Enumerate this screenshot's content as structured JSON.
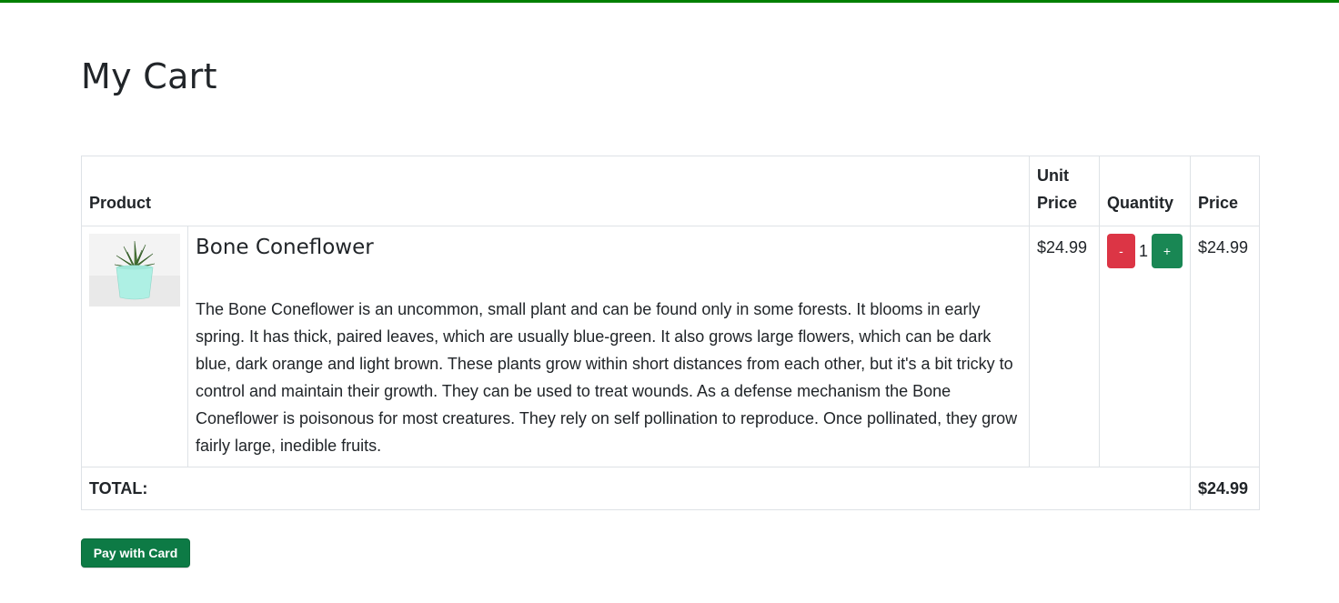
{
  "colors": {
    "top_bar": "#008000",
    "minus_button": "#dc3545",
    "plus_button": "#198754",
    "pay_button": "#0d7a45",
    "pot": "#aef0e4"
  },
  "page": {
    "title": "My Cart"
  },
  "table": {
    "headers": {
      "product": "Product",
      "unit_price": "Unit Price",
      "quantity": "Quantity",
      "price": "Price"
    },
    "rows": [
      {
        "image_icon": "potted-succulent-image",
        "name": "Bone Coneflower",
        "description": "The Bone Coneflower is an uncommon, small plant and can be found only in some forests. It blooms in early spring. It has thick, paired leaves, which are usually blue-green. It also grows large flowers, which can be dark blue, dark orange and light brown. These plants grow within short distances from each other, but it's a bit tricky to control and maintain their growth. They can be used to treat wounds. As a defense mechanism the Bone Coneflower is poisonous for most creatures. They rely on self pollination to reproduce. Once pollinated, they grow fairly large, inedible fruits.",
        "unit_price": "$24.99",
        "decrease_label": "-",
        "quantity": "1",
        "increase_label": "+",
        "price": "$24.99"
      }
    ],
    "total": {
      "label": "TOTAL:",
      "value": "$24.99"
    }
  },
  "actions": {
    "pay_label": "Pay with Card"
  }
}
